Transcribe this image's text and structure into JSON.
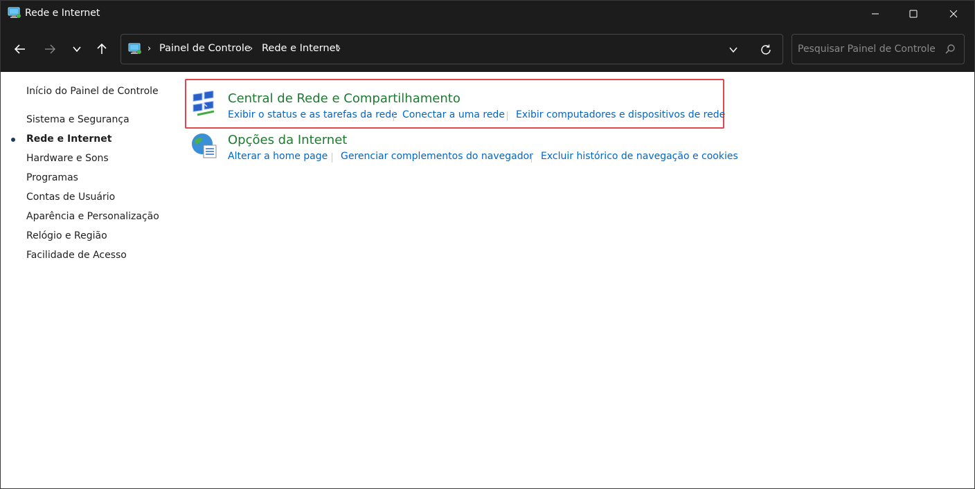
{
  "window": {
    "title": "Rede e Internet"
  },
  "toolbar": {
    "breadcrumb": [
      "Painel de Controle",
      "Rede e Internet"
    ],
    "search_placeholder": "Pesquisar Painel de Controle"
  },
  "sidebar": {
    "home": "Início do Painel de Controle",
    "items": [
      {
        "label": "Sistema e Segurança",
        "active": false
      },
      {
        "label": "Rede e Internet",
        "active": true
      },
      {
        "label": "Hardware e Sons",
        "active": false
      },
      {
        "label": "Programas",
        "active": false
      },
      {
        "label": "Contas de Usuário",
        "active": false
      },
      {
        "label": "Aparência e Personalização",
        "active": false
      },
      {
        "label": "Relógio e Região",
        "active": false
      },
      {
        "label": "Facilidade de Acesso",
        "active": false
      }
    ]
  },
  "categories": [
    {
      "title": "Central de Rede e Compartilhamento",
      "icon": "network-sharing-icon",
      "highlighted": true,
      "tasks": [
        "Exibir o status e as tarefas da rede",
        "Conectar a uma rede",
        "Exibir computadores e dispositivos de rede"
      ]
    },
    {
      "title": "Opções da Internet",
      "icon": "internet-options-icon",
      "highlighted": false,
      "tasks": [
        "Alterar a home page",
        "Gerenciar complementos do navegador",
        "Excluir histórico de navegação e cookies"
      ]
    }
  ],
  "colors": {
    "titlebar_bg": "#1c1c1c",
    "category_title": "#1b7b2e",
    "task_link": "#0066cc",
    "highlight_border": "#e0474c"
  }
}
